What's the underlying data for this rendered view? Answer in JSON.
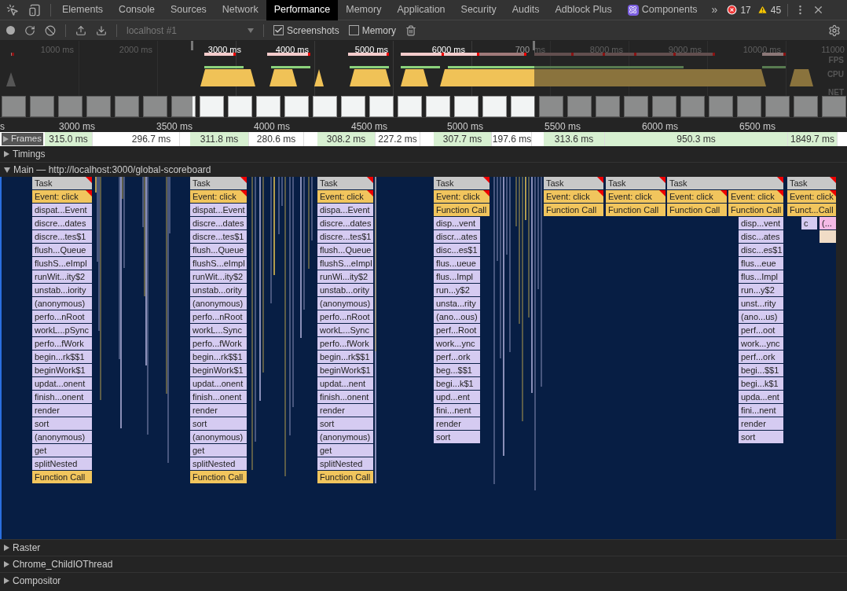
{
  "tabs": [
    {
      "label": "Elements",
      "selected": false
    },
    {
      "label": "Console",
      "selected": false
    },
    {
      "label": "Sources",
      "selected": false
    },
    {
      "label": "Network",
      "selected": false
    },
    {
      "label": "Performance",
      "selected": true
    },
    {
      "label": "Memory",
      "selected": false
    },
    {
      "label": "Application",
      "selected": false
    },
    {
      "label": "Security",
      "selected": false
    },
    {
      "label": "Audits",
      "selected": false
    },
    {
      "label": "Adblock Plus",
      "selected": false
    },
    {
      "label": "Components",
      "selected": false,
      "kind": "react"
    }
  ],
  "more_tabs": "»",
  "errors": "17",
  "warnings": "45",
  "toolbar": {
    "profile_select": "localhost #1",
    "screenshots": {
      "label": "Screenshots",
      "checked": true
    },
    "memory": {
      "label": "Memory",
      "checked": false
    }
  },
  "overview": {
    "ticks": [
      "1000 ms",
      "2000 ms",
      "3000 ms",
      "4000 ms",
      "5000 ms",
      "6000 ms",
      "700",
      "ms",
      "8000 ms",
      "9000 ms",
      "10000 ms",
      "11000"
    ],
    "lanes": [
      "FPS",
      "CPU",
      "NET"
    ]
  },
  "ruler": [
    "s",
    "3000 ms",
    "3500 ms",
    "4000 ms",
    "4500 ms",
    "5000 ms",
    "5500 ms",
    "6000 ms",
    "6500 ms"
  ],
  "frames_track": {
    "label": "Frames",
    "expanded": false,
    "frames": [
      {
        "duration": "315.0 ms",
        "highlighted": true
      },
      {
        "duration": "296.7 ms",
        "highlighted": false
      },
      {
        "duration": "311.8 ms",
        "highlighted": true
      },
      {
        "duration": "280.6 ms",
        "highlighted": false
      },
      {
        "duration": "308.2 ms",
        "highlighted": true
      },
      {
        "duration": "227.2 ms",
        "highlighted": false
      },
      {
        "duration": "307.7 ms",
        "highlighted": true
      },
      {
        "duration": "197.6 ms",
        "highlighted": false
      },
      {
        "duration": "313.6 ms",
        "highlighted": true
      },
      {
        "duration": "950.3 ms",
        "highlighted": true
      },
      {
        "duration": "1849.7 ms",
        "highlighted": true
      }
    ]
  },
  "timings_track": {
    "label": "Timings",
    "expanded": false
  },
  "main_track": {
    "label": "Main — http://localhost:3000/global-scoreboard",
    "expanded": true,
    "columns": [
      {
        "frames": [
          {
            "name": "Task",
            "kind": "task"
          },
          {
            "name": "Event: click",
            "kind": "event"
          },
          {
            "name": "dispat...Event",
            "kind": "js"
          },
          {
            "name": "discre...dates",
            "kind": "js"
          },
          {
            "name": "discre...tes$1",
            "kind": "js"
          },
          {
            "name": "flush...Queue",
            "kind": "js"
          },
          {
            "name": "flushS...eImpl",
            "kind": "js"
          },
          {
            "name": "runWit...ity$2",
            "kind": "js"
          },
          {
            "name": "unstab...iority",
            "kind": "js"
          },
          {
            "name": "(anonymous)",
            "kind": "js"
          },
          {
            "name": "perfo...nRoot",
            "kind": "js"
          },
          {
            "name": "workL...pSync",
            "kind": "js"
          },
          {
            "name": "perfo...fWork",
            "kind": "js"
          },
          {
            "name": "begin...rk$$1",
            "kind": "js"
          },
          {
            "name": "beginWork$1",
            "kind": "js"
          },
          {
            "name": "updat...onent",
            "kind": "js"
          },
          {
            "name": "finish...onent",
            "kind": "js"
          },
          {
            "name": "render",
            "kind": "js"
          },
          {
            "name": "sort",
            "kind": "js"
          },
          {
            "name": "(anonymous)",
            "kind": "js"
          },
          {
            "name": "get",
            "kind": "js"
          },
          {
            "name": "splitNested",
            "kind": "js"
          },
          {
            "name": "Function Call",
            "kind": "call"
          }
        ]
      },
      {
        "frames": [
          {
            "name": "Task",
            "kind": "task"
          },
          {
            "name": "Event: click",
            "kind": "event"
          },
          {
            "name": "dispat...Event",
            "kind": "js"
          },
          {
            "name": "discre...dates",
            "kind": "js"
          },
          {
            "name": "discre...tes$1",
            "kind": "js"
          },
          {
            "name": "flush...Queue",
            "kind": "js"
          },
          {
            "name": "flushS...eImpl",
            "kind": "js"
          },
          {
            "name": "runWit...ity$2",
            "kind": "js"
          },
          {
            "name": "unstab...ority",
            "kind": "js"
          },
          {
            "name": "(anonymous)",
            "kind": "js"
          },
          {
            "name": "perfo...nRoot",
            "kind": "js"
          },
          {
            "name": "workL...Sync",
            "kind": "js"
          },
          {
            "name": "perfo...fWork",
            "kind": "js"
          },
          {
            "name": "begin...rk$$1",
            "kind": "js"
          },
          {
            "name": "beginWork$1",
            "kind": "js"
          },
          {
            "name": "updat...onent",
            "kind": "js"
          },
          {
            "name": "finish...onent",
            "kind": "js"
          },
          {
            "name": "render",
            "kind": "js"
          },
          {
            "name": "sort",
            "kind": "js"
          },
          {
            "name": "(anonymous)",
            "kind": "js"
          },
          {
            "name": "get",
            "kind": "js"
          },
          {
            "name": "splitNested",
            "kind": "js"
          },
          {
            "name": "Function Call",
            "kind": "call"
          }
        ]
      },
      {
        "frames": [
          {
            "name": "Task",
            "kind": "task"
          },
          {
            "name": "Event: click",
            "kind": "event"
          },
          {
            "name": "dispa...Event",
            "kind": "js"
          },
          {
            "name": "discre...dates",
            "kind": "js"
          },
          {
            "name": "discre...tes$1",
            "kind": "js"
          },
          {
            "name": "flush...Queue",
            "kind": "js"
          },
          {
            "name": "flushS...eImpl",
            "kind": "js"
          },
          {
            "name": "runWi...ity$2",
            "kind": "js"
          },
          {
            "name": "unstab...ority",
            "kind": "js"
          },
          {
            "name": "(anonymous)",
            "kind": "js"
          },
          {
            "name": "perfo...nRoot",
            "kind": "js"
          },
          {
            "name": "workL...Sync",
            "kind": "js"
          },
          {
            "name": "perfo...fWork",
            "kind": "js"
          },
          {
            "name": "begin...rk$$1",
            "kind": "js"
          },
          {
            "name": "beginWork$1",
            "kind": "js"
          },
          {
            "name": "updat...nent",
            "kind": "js"
          },
          {
            "name": "finish...onent",
            "kind": "js"
          },
          {
            "name": "render",
            "kind": "js"
          },
          {
            "name": "sort",
            "kind": "js"
          },
          {
            "name": "(anonymous)",
            "kind": "js"
          },
          {
            "name": "get",
            "kind": "js"
          },
          {
            "name": "splitNested",
            "kind": "js"
          },
          {
            "name": "Function Call",
            "kind": "call"
          }
        ]
      },
      {
        "frames": [
          {
            "name": "Task",
            "kind": "task"
          },
          {
            "name": "Event: click",
            "kind": "event"
          },
          {
            "name": "Function Call",
            "kind": "call"
          }
        ]
      },
      {
        "frames": [
          {
            "name": "disp...vent",
            "kind": "js"
          },
          {
            "name": "discr...ates",
            "kind": "js"
          },
          {
            "name": "disc...es$1",
            "kind": "js"
          },
          {
            "name": "flus...ueue",
            "kind": "js"
          },
          {
            "name": "flus...Impl",
            "kind": "js"
          },
          {
            "name": "run...y$2",
            "kind": "js"
          },
          {
            "name": "unsta...rity",
            "kind": "js"
          },
          {
            "name": "(ano...ous)",
            "kind": "js"
          },
          {
            "name": "perf...Root",
            "kind": "js"
          },
          {
            "name": "work...ync",
            "kind": "js"
          },
          {
            "name": "perf...ork",
            "kind": "js"
          },
          {
            "name": "beg...$$1",
            "kind": "js"
          },
          {
            "name": "begi...k$1",
            "kind": "js"
          },
          {
            "name": "upd...ent",
            "kind": "js"
          },
          {
            "name": "fini...nent",
            "kind": "js"
          },
          {
            "name": "render",
            "kind": "js"
          },
          {
            "name": "sort",
            "kind": "js"
          }
        ]
      },
      {
        "frames": [
          {
            "name": "Task",
            "kind": "task"
          },
          {
            "name": "Event: click",
            "kind": "event"
          },
          {
            "name": "Function Call",
            "kind": "call"
          }
        ]
      },
      {
        "frames": [
          {
            "name": "Task",
            "kind": "task"
          },
          {
            "name": "Event: click",
            "kind": "event"
          },
          {
            "name": "Function Call",
            "kind": "call"
          }
        ]
      },
      {
        "frames": [
          {
            "name": "Task",
            "kind": "task"
          },
          {
            "name": "Event: click",
            "kind": "event"
          },
          {
            "name": "Function Call",
            "kind": "call"
          }
        ]
      },
      {
        "frames": [
          {
            "name": "Event: click",
            "kind": "event"
          },
          {
            "name": "Function Call",
            "kind": "call"
          }
        ]
      },
      {
        "frames": [
          {
            "name": "disp...vent",
            "kind": "js"
          },
          {
            "name": "disc...ates",
            "kind": "js"
          },
          {
            "name": "disc...es$1",
            "kind": "js"
          },
          {
            "name": "flus...eue",
            "kind": "js"
          },
          {
            "name": "flus...Impl",
            "kind": "js"
          },
          {
            "name": "run...y$2",
            "kind": "js"
          },
          {
            "name": "unst...rity",
            "kind": "js"
          },
          {
            "name": "(ano...us)",
            "kind": "js"
          },
          {
            "name": "perf...oot",
            "kind": "js"
          },
          {
            "name": "work...ync",
            "kind": "js"
          },
          {
            "name": "perf...ork",
            "kind": "js"
          },
          {
            "name": "begi...$$1",
            "kind": "js"
          },
          {
            "name": "begi...k$1",
            "kind": "js"
          },
          {
            "name": "upda...ent",
            "kind": "js"
          },
          {
            "name": "fini...nent",
            "kind": "js"
          },
          {
            "name": "render",
            "kind": "js"
          },
          {
            "name": "sort",
            "kind": "js"
          }
        ]
      },
      {
        "frames": [
          {
            "name": "Task",
            "kind": "task"
          },
          {
            "name": "Event: click",
            "kind": "event"
          },
          {
            "name": "Funct...Call",
            "kind": "call"
          }
        ]
      },
      {
        "frames": [
          {
            "name": "c",
            "kind": "js"
          }
        ]
      },
      {
        "frames": [
          {
            "name": "(...",
            "kind": "pink"
          },
          {
            "kind": "paint"
          }
        ]
      }
    ]
  },
  "other_tracks": [
    {
      "label": "Raster",
      "expanded": false
    },
    {
      "label": "Chrome_ChildIOThread",
      "expanded": false
    },
    {
      "label": "Compositor",
      "expanded": false
    }
  ]
}
